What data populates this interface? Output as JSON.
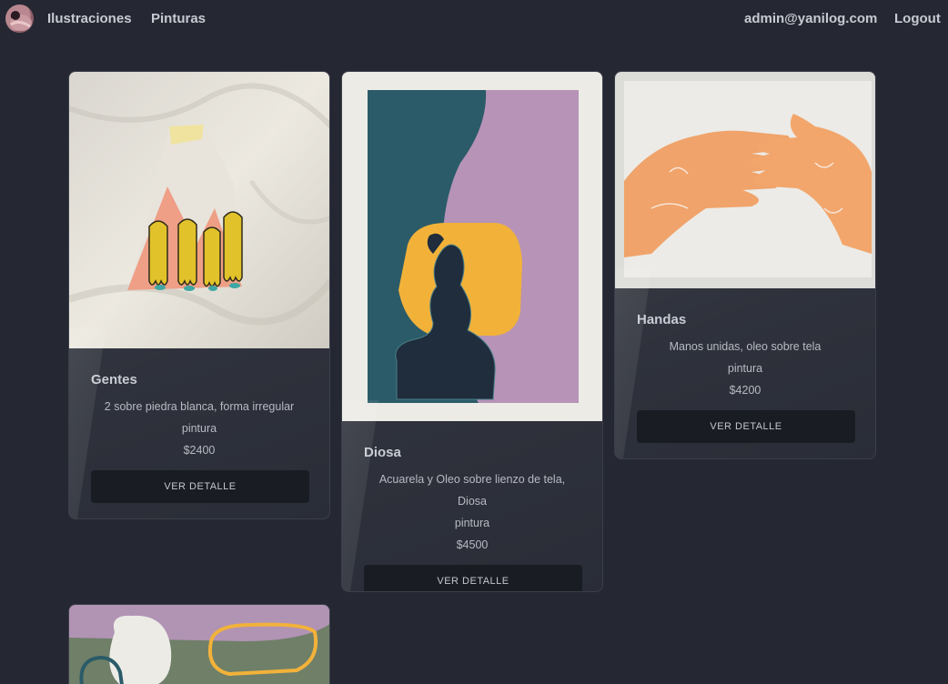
{
  "nav": {
    "logo_icon": "avatar-logo",
    "link_ilustraciones": "Ilustraciones",
    "link_pinturas": "Pinturas",
    "user_email": "admin@yanilog.com",
    "logout": "Logout"
  },
  "cards": [
    {
      "title": "Gentes",
      "description": "2 sobre piedra blanca, forma irregular",
      "category": "pintura",
      "price": "$2400",
      "button": "VER DETALLE"
    },
    {
      "title": "Diosa",
      "description": "Acuarela y Oleo sobre lienzo de tela, Diosa",
      "category": "pintura",
      "price": "$4500",
      "button": "VER DETALLE"
    },
    {
      "title": "Handas",
      "description": "Manos unidas, oleo sobre tela",
      "category": "pintura",
      "price": "$4200",
      "button": "VER DETALLE"
    }
  ],
  "colors": {
    "background": "#252833",
    "card": "#363943",
    "button": "#1a1c24"
  }
}
